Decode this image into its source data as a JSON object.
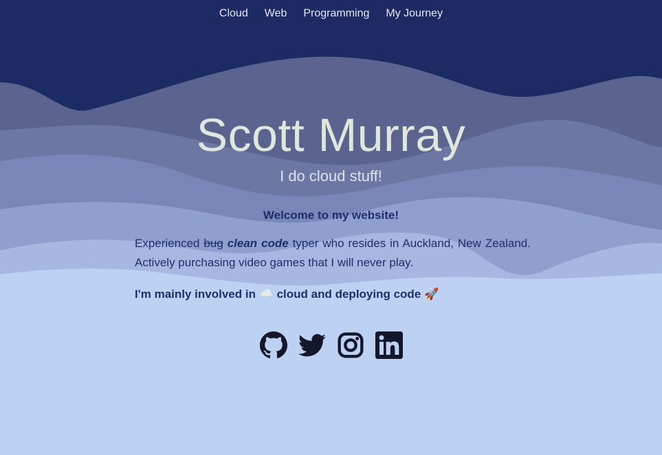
{
  "nav": {
    "items": [
      {
        "label": "Cloud"
      },
      {
        "label": "Web"
      },
      {
        "label": "Programming"
      },
      {
        "label": "My Journey"
      }
    ]
  },
  "hero": {
    "title": "Scott Murray",
    "subtitle": "I do cloud stuff!"
  },
  "intro": {
    "heading": "Welcome to my website!",
    "text_before": "Experienced",
    "strike_word": "bug",
    "emphasis": "clean code",
    "text_after": "typer who resides in Auckland, New Zealand. Actively purchasing video games that I will never play.",
    "involvement": "I'm mainly involved in ☁️ cloud and deploying code 🚀"
  },
  "socials": [
    {
      "name": "github-icon"
    },
    {
      "name": "twitter-icon"
    },
    {
      "name": "instagram-icon"
    },
    {
      "name": "linkedin-icon"
    }
  ],
  "colors": {
    "navbar": "#1d2a63",
    "wave_dark": "#1c2b64",
    "wave_mid": "#5a648f",
    "wave_light": "#bdd2f3",
    "text_dark": "#1f2f6b",
    "title": "#dfe6dc",
    "icon": "#14162a"
  }
}
